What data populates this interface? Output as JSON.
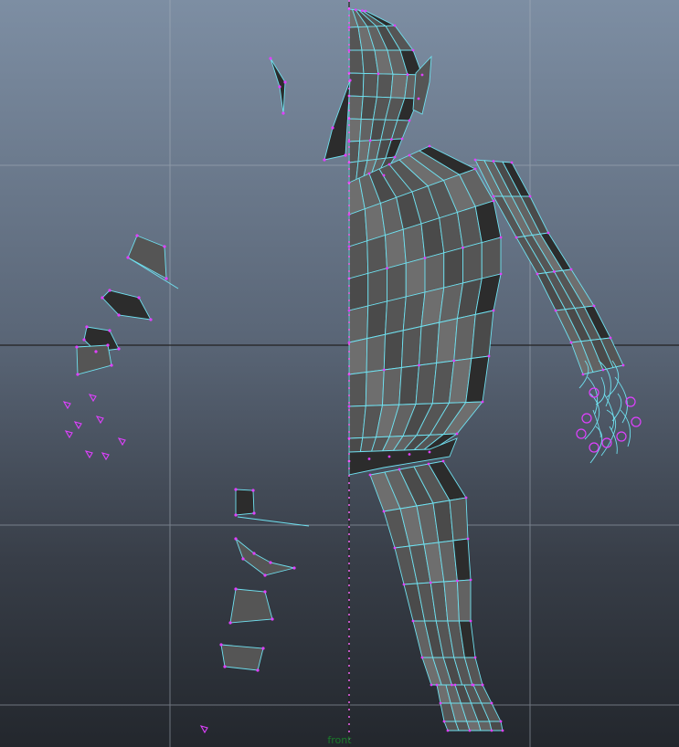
{
  "viewport": {
    "camera_label": "front"
  },
  "colors": {
    "wire": "#6fe0ef",
    "vertex": "#e040ff",
    "grid": "#a9b2bd",
    "axis": "#222222",
    "symmetry": "#ff66ff",
    "face_dark": "#2c2c2c",
    "face_mid": "#555555",
    "face_light": "#6e6e6e"
  }
}
